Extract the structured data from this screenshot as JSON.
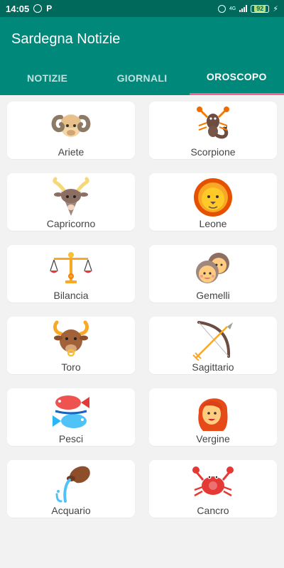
{
  "status_bar": {
    "time": "14:05",
    "network": "4G",
    "battery": "92"
  },
  "app_bar": {
    "title": "Sardegna Notizie"
  },
  "tabs": [
    {
      "label": "NOTIZIE",
      "active": false
    },
    {
      "label": "GIORNALI",
      "active": false
    },
    {
      "label": "OROSCOPO",
      "active": true
    }
  ],
  "signs": [
    {
      "label": "Ariete",
      "icon": "ram-icon"
    },
    {
      "label": "Scorpione",
      "icon": "scorpion-icon"
    },
    {
      "label": "Capricorno",
      "icon": "goat-icon"
    },
    {
      "label": "Leone",
      "icon": "lion-icon"
    },
    {
      "label": "Bilancia",
      "icon": "scales-icon"
    },
    {
      "label": "Gemelli",
      "icon": "twins-icon"
    },
    {
      "label": "Toro",
      "icon": "bull-icon"
    },
    {
      "label": "Sagittario",
      "icon": "bow-arrow-icon"
    },
    {
      "label": "Pesci",
      "icon": "fish-icon"
    },
    {
      "label": "Vergine",
      "icon": "woman-icon"
    },
    {
      "label": "Acquario",
      "icon": "water-jug-icon"
    },
    {
      "label": "Cancro",
      "icon": "crab-icon"
    }
  ],
  "colors": {
    "status_bar": "#00695c",
    "app_bar": "#00897b",
    "tab_indicator": "#f06292",
    "background": "#f2f2f2",
    "card": "#ffffff"
  }
}
